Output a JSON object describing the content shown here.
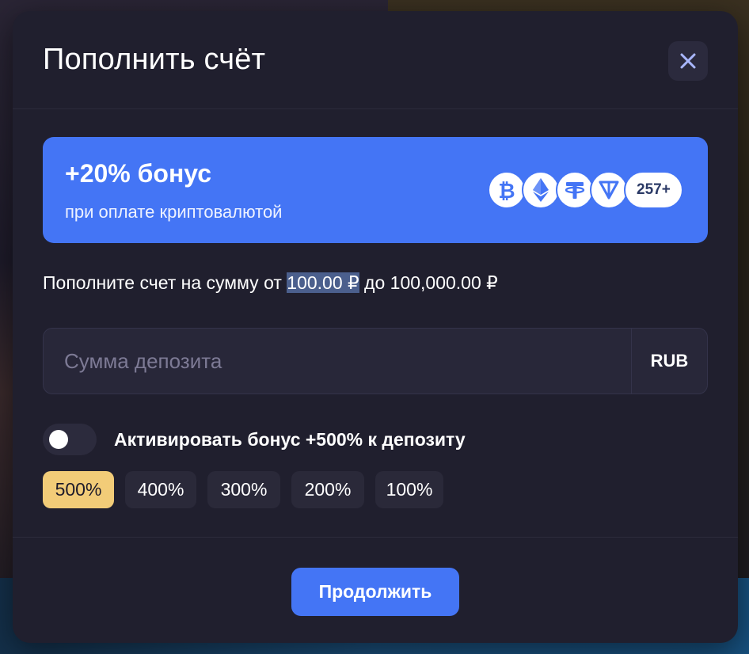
{
  "modal": {
    "title": "Пополнить счёт"
  },
  "banner": {
    "title": "+20% бонус",
    "subtitle": "при оплате криптовалютой",
    "coins": [
      "bitcoin-icon",
      "ethereum-icon",
      "tether-icon",
      "ton-icon"
    ],
    "more_count": "257+"
  },
  "range": {
    "prefix": "Пополните счет на сумму от ",
    "min": "100.00 ₽",
    "middle": " до ",
    "max": "100,000.00 ₽"
  },
  "amount": {
    "placeholder": "Сумма депозита",
    "value": "",
    "currency": "RUB"
  },
  "bonus": {
    "label": "Активировать бонус +500% к депозиту",
    "enabled": false,
    "options": [
      "500%",
      "400%",
      "300%",
      "200%",
      "100%"
    ],
    "selected": "500%"
  },
  "footer": {
    "continue_label": "Продолжить"
  },
  "colors": {
    "modal_bg": "#201f2e",
    "accent": "#4475f5",
    "selected_pill": "#f2cc78"
  }
}
